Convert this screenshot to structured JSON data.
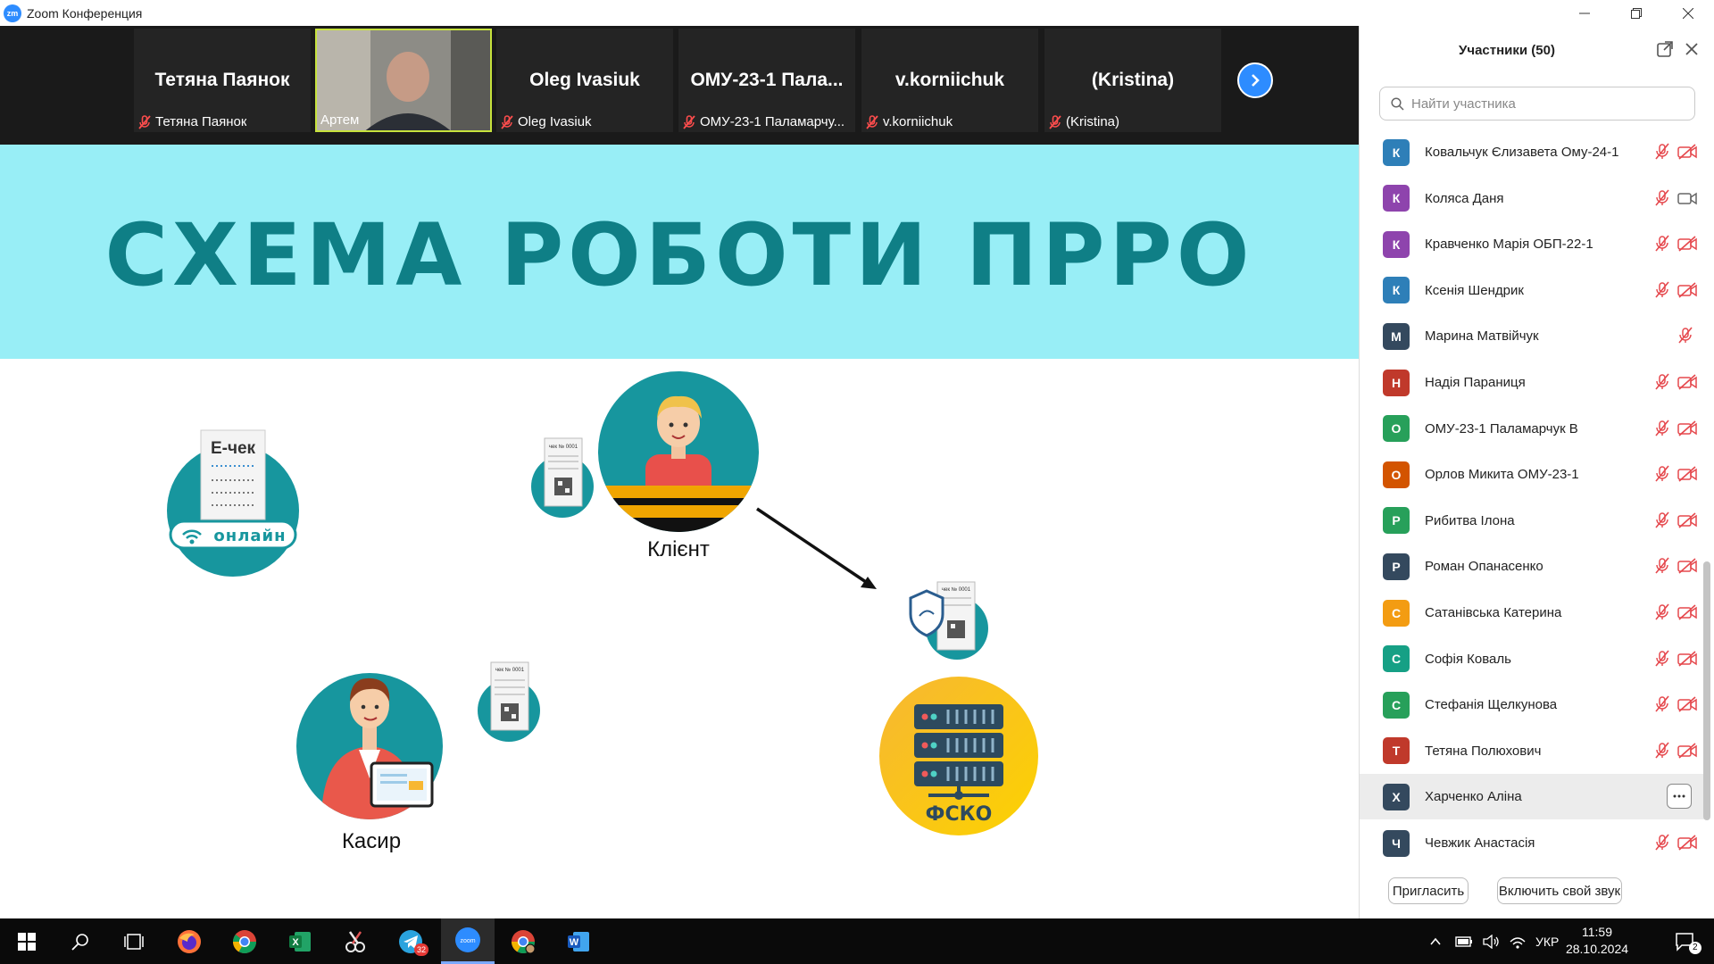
{
  "window": {
    "title": "Zoom Конференция",
    "app_icon": "zm"
  },
  "video_strip": {
    "tiles": [
      {
        "name": "Тетяна Паянок",
        "label": "Тетяна Паянок"
      },
      {
        "name": "",
        "label": "Артем"
      },
      {
        "name": "Oleg Ivasiuk",
        "label": "Oleg Ivasiuk"
      },
      {
        "name": "ОМУ-23-1 Пала...",
        "label": "ОМУ-23-1 Паламарчу..."
      },
      {
        "name": "v.korniichuk",
        "label": "v.korniichuk"
      },
      {
        "name": "(Kristina)",
        "label": "(Kristina)"
      }
    ]
  },
  "slide": {
    "title": "СХЕМА РОБОТИ ПРРО",
    "echeck_title": "Е-чек",
    "echeck_badge": "онлайн",
    "client_label": "Клієнт",
    "cashier_label": "Касир",
    "server_label": "ФСКО",
    "receipt_label": "чек № 0001"
  },
  "panel": {
    "title": "Участники (50)",
    "search_placeholder": "Найти участника",
    "participants": [
      {
        "initial": "К",
        "name": "Ковальчук Єлизавета Ому-24-1",
        "color": "#2e7fb8",
        "mic": "muted",
        "video": "off"
      },
      {
        "initial": "К",
        "name": "Коляса Даня",
        "color": "#8e44ad",
        "mic": "muted",
        "video": "on"
      },
      {
        "initial": "К",
        "name": "Кравченко Марія ОБП-22-1",
        "color": "#8e44ad",
        "mic": "muted",
        "video": "off"
      },
      {
        "initial": "К",
        "name": "Ксенія Шендрик",
        "color": "#2e7fb8",
        "mic": "muted",
        "video": "off"
      },
      {
        "initial": "М",
        "name": "Марина Матвійчук",
        "color": "#34495e",
        "mic": "muted",
        "video": "none"
      },
      {
        "initial": "Н",
        "name": "Надія Параниця",
        "color": "#c0392b",
        "mic": "muted",
        "video": "off"
      },
      {
        "initial": "О",
        "name": "ОМУ-23-1 Паламарчук В",
        "color": "#27a05a",
        "mic": "muted",
        "video": "off"
      },
      {
        "initial": "О",
        "name": "Орлов Микита ОМУ-23-1",
        "color": "#d35400",
        "mic": "muted",
        "video": "off"
      },
      {
        "initial": "Р",
        "name": "Рибитва Ілона",
        "color": "#27a05a",
        "mic": "muted",
        "video": "off"
      },
      {
        "initial": "Р",
        "name": "Роман Опанасенко",
        "color": "#34495e",
        "mic": "muted",
        "video": "off"
      },
      {
        "initial": "С",
        "name": "Сатанівська Катерина",
        "color": "#f39c12",
        "mic": "muted",
        "video": "off"
      },
      {
        "initial": "С",
        "name": "Софія Коваль",
        "color": "#16a085",
        "mic": "muted",
        "video": "off"
      },
      {
        "initial": "С",
        "name": "Стефанія Щелкунова",
        "color": "#27a05a",
        "mic": "muted",
        "video": "off"
      },
      {
        "initial": "Т",
        "name": "Тетяна Полюхович",
        "color": "#c0392b",
        "mic": "muted",
        "video": "off"
      },
      {
        "initial": "Х",
        "name": "Харченко Аліна",
        "color": "#34495e",
        "mic": "more",
        "video": "more",
        "highlighted": true
      },
      {
        "initial": "Ч",
        "name": "Чевжик Анастасія",
        "color": "#34495e",
        "mic": "muted",
        "video": "off"
      }
    ],
    "invite_label": "Пригласить",
    "unmute_label": "Включить свой звук"
  },
  "taskbar": {
    "apps": [
      "windows-start",
      "search",
      "task-view",
      "firefox",
      "chrome",
      "excel",
      "snipping-tool",
      "telegram",
      "zoom",
      "chrome-profile",
      "word"
    ],
    "telegram_badge": "32",
    "language": "УКР",
    "time": "11:59",
    "date": "28.10.2024",
    "notification_count": "2"
  }
}
